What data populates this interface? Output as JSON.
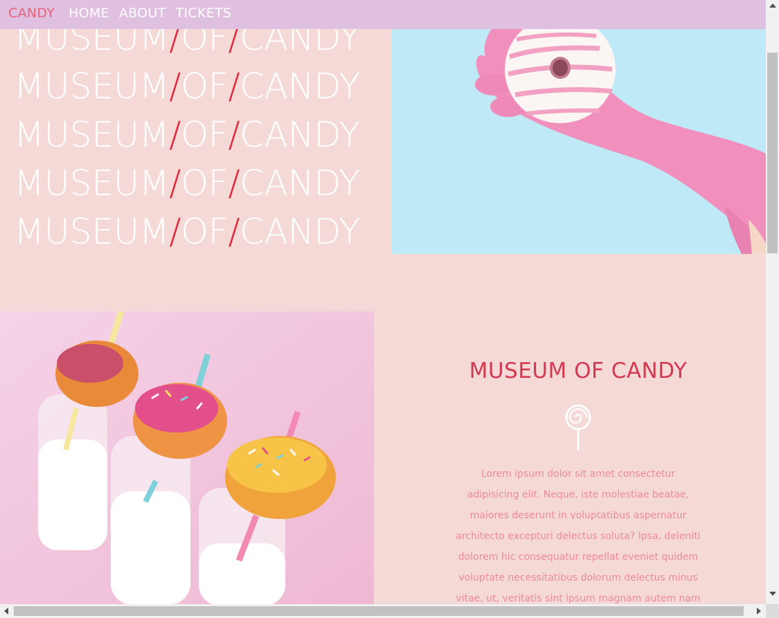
{
  "nav": {
    "brand": "CANDY",
    "links": [
      "HOME",
      "ABOUT",
      "TICKETS"
    ]
  },
  "hero": {
    "lines": [
      {
        "a": "MUSEUM",
        "sep1": "/",
        "b": "OF",
        "sep2": "/",
        "c": "CANDY"
      },
      {
        "a": "MUSEUM",
        "sep1": "/",
        "b": "OF",
        "sep2": "/",
        "c": "CANDY"
      },
      {
        "a": "MUSEUM",
        "sep1": "/",
        "b": "OF",
        "sep2": "/",
        "c": "CANDY"
      },
      {
        "a": "MUSEUM",
        "sep1": "/",
        "b": "OF",
        "sep2": "/",
        "c": "CANDY"
      },
      {
        "a": "MUSEUM",
        "sep1": "/",
        "b": "OF",
        "sep2": "/",
        "c": "CANDY"
      }
    ]
  },
  "info": {
    "title": "MUSEUM OF CANDY",
    "icon": "lollipop-icon",
    "paragraph": "Lorem ipsum dolor sit amet consectetur adipisicing elit. Neque, iste molestiae beatae, maiores deserunt in voluptatibus aspernatur architecto excepturi delectus soluta? Ipsa, deleniti dolorem hic consequatur repellat eveniet quidem voluptate necessitatibus dolorum delectus minus vitae, ut, veritatis sint ipsum magnam autem nam ex deserunt debitis eaque ratione! Nobis"
  },
  "colors": {
    "page_bg": "#f4d9d7",
    "nav_bg": "#dfc0e0",
    "brand": "#e8607a",
    "slash": "#e2263a",
    "title": "#d33950",
    "paragraph": "#ee8a99"
  }
}
